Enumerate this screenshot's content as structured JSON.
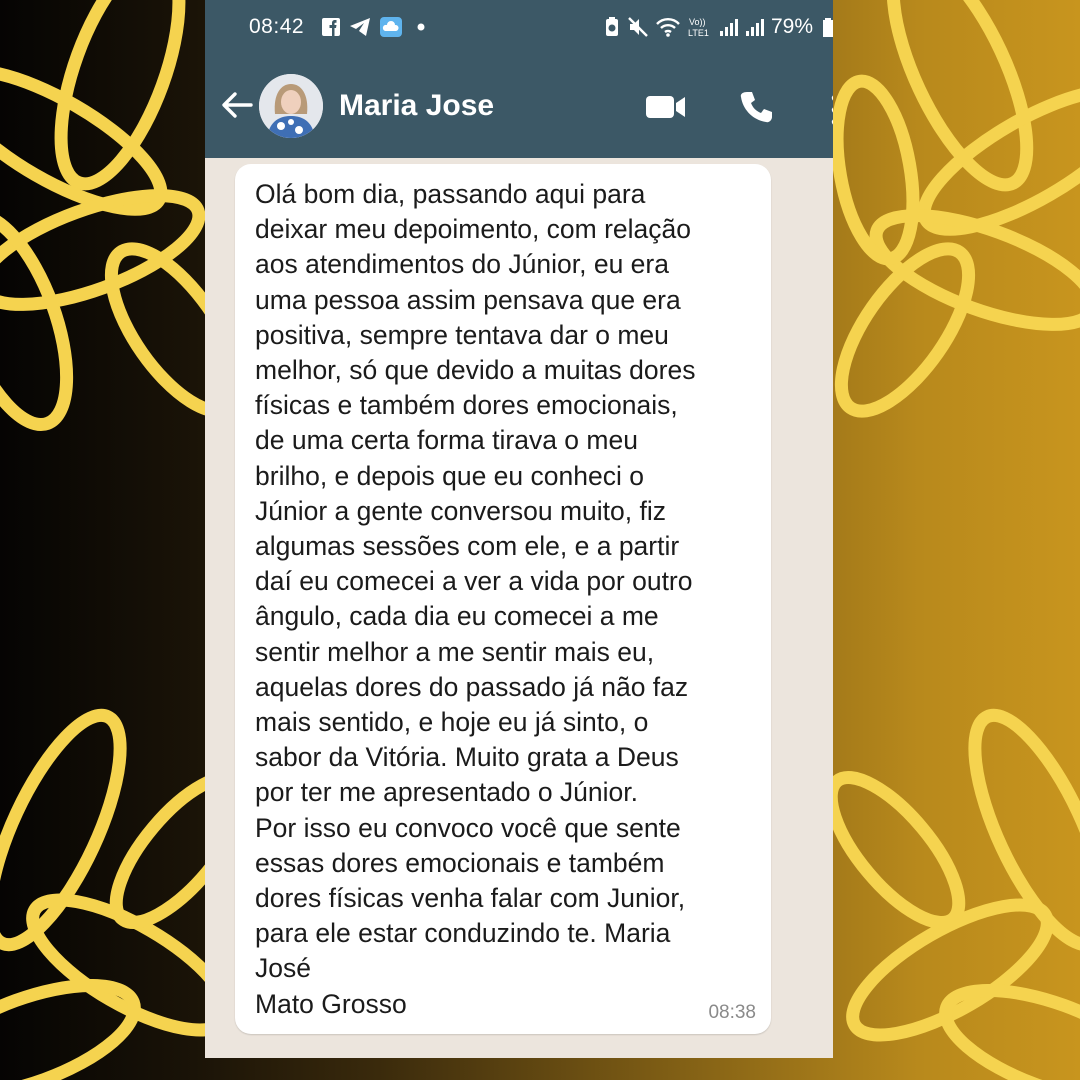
{
  "status_bar": {
    "time": "08:42",
    "left_icons": [
      "facebook-icon",
      "telegram-icon",
      "cloud-app-icon",
      "dot-icon"
    ],
    "right_icons": [
      "battery-saver-icon",
      "mute-icon",
      "wifi-icon",
      "volte-icon",
      "signal-icon",
      "signal-icon"
    ],
    "volte_label": "Vo)) LTE1",
    "battery": "79%"
  },
  "chat_header": {
    "contact_name": "Maria Jose",
    "actions": [
      "video-call-icon",
      "voice-call-icon",
      "more-options-icon"
    ]
  },
  "message": {
    "text": "Olá bom dia, passando aqui para\ndeixar meu depoimento, com relação\naos atendimentos do Júnior, eu era\numa pessoa assim pensava que era\npositiva, sempre tentava dar o meu\nmelhor, só que devido a muitas dores\nfísicas e também dores emocionais,\nde uma certa forma tirava o meu\nbrilho, e depois que eu conheci o\nJúnior a gente conversou muito, fiz\nalgumas sessões com ele, e a partir\ndaí eu comecei a ver a vida por outro\nângulo, cada dia eu comecei a me\nsentir melhor a me sentir mais eu,\naquelas dores do passado já não faz\nmais sentido, e hoje eu já sinto, o\nsabor da Vitória. Muito grata a Deus\npor ter me apresentado o Júnior.\nPor isso eu convoco você que sente\nessas dores emocionais e também\ndores físicas venha falar com Junior,\npara ele estar conduzindo te.   Maria\nJosé\nMato Grosso",
    "time": "08:38"
  },
  "colors": {
    "header": "#3c5866",
    "chat_background": "#ece5dd",
    "bubble": "#ffffff",
    "petal": "#f5d34f"
  }
}
